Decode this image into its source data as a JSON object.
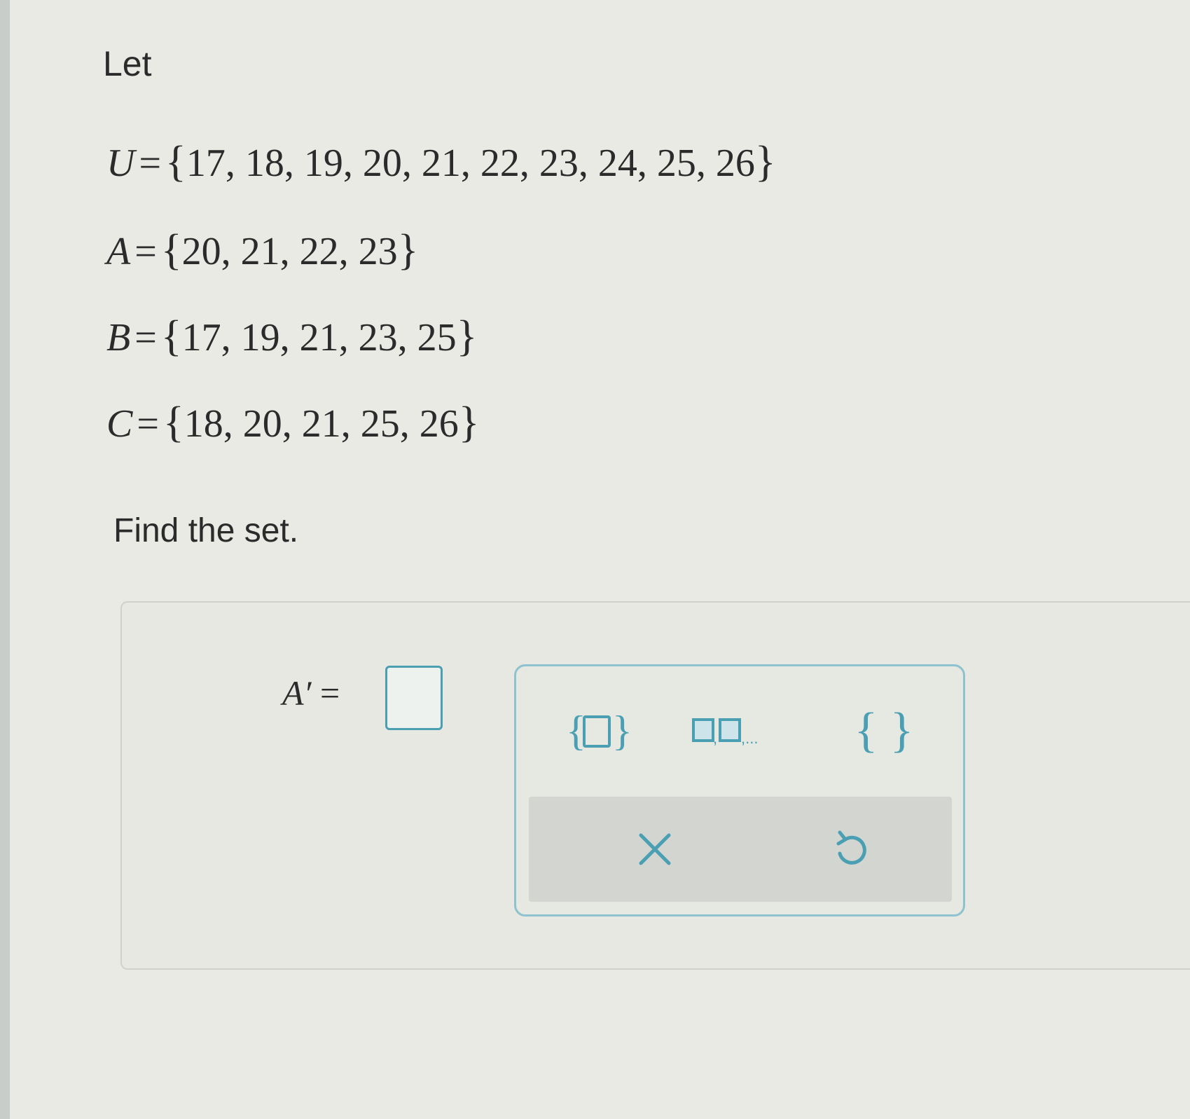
{
  "intro": "Let",
  "sets": [
    {
      "name": "U",
      "elements": "17, 18, 19, 20, 21, 22, 23, 24, 25, 26"
    },
    {
      "name": "A",
      "elements": "20, 21, 22, 23"
    },
    {
      "name": "B",
      "elements": "17, 19, 21, 23, 25"
    },
    {
      "name": "C",
      "elements": "18, 20, 21, 25, 26"
    }
  ],
  "prompt": "Find the set.",
  "answer": {
    "label": "A′",
    "equals": "=",
    "value": ""
  },
  "palette": {
    "empty_set_glyph": "{ }"
  },
  "colors": {
    "accent": "#4a9fb3",
    "background": "#e9eae4"
  },
  "icons": {
    "set_template": "braces-with-box-icon",
    "list_template": "boxes-list-icon",
    "empty_set": "empty-braces-icon",
    "clear": "x-icon",
    "undo": "undo-icon"
  }
}
